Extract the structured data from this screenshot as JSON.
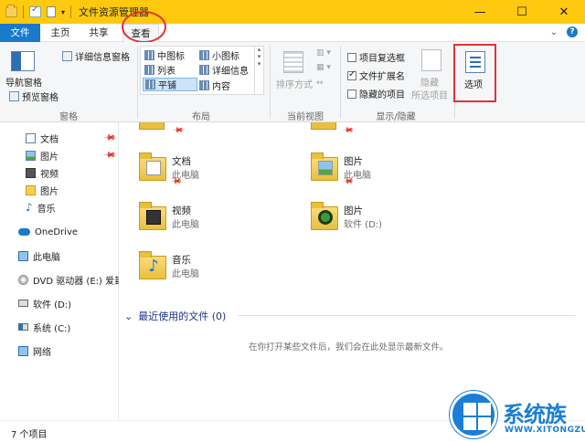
{
  "window": {
    "title": "文件资源管理器",
    "controls": {
      "minimize": "—",
      "maximize": "☐",
      "close": "✕"
    }
  },
  "tabs": {
    "file": "文件",
    "home": "主页",
    "share": "共享",
    "view": "查看",
    "expand": "⌄",
    "help": "?"
  },
  "ribbon": {
    "panes": {
      "label": "窗格",
      "nav_pane": "导航窗格",
      "preview_pane": "预览窗格",
      "details_pane": "详细信息窗格"
    },
    "layout": {
      "label": "布局",
      "items": [
        "中图标",
        "小图标",
        "列表",
        "详细信息",
        "平铺",
        "内容"
      ],
      "selected": "平铺"
    },
    "current_view": {
      "label": "当前视图",
      "sort_by": "排序方式"
    },
    "show_hide": {
      "label": "显示/隐藏",
      "item_checkboxes": "项目复选框",
      "file_extensions": "文件扩展名",
      "hidden_items": "隐藏的项目",
      "hide_selected_line1": "隐藏",
      "hide_selected_line2": "所选项目"
    },
    "options": {
      "label": "选项"
    }
  },
  "nav": {
    "items": [
      {
        "label": "文档",
        "icon": "document-icon",
        "pinned": true
      },
      {
        "label": "图片",
        "icon": "pictures-icon",
        "pinned": true
      },
      {
        "label": "视频",
        "icon": "video-icon",
        "pinned": false
      },
      {
        "label": "图片",
        "icon": "folder-icon",
        "pinned": false
      },
      {
        "label": "音乐",
        "icon": "music-icon",
        "pinned": false
      },
      {
        "label": "OneDrive",
        "icon": "onedrive-icon",
        "pinned": false
      },
      {
        "label": "此电脑",
        "icon": "this-pc-icon",
        "pinned": false
      },
      {
        "label": "DVD 驱动器 (E:) 爱封",
        "icon": "dvd-drive-icon",
        "pinned": false
      },
      {
        "label": "软件 (D:)",
        "icon": "drive-icon",
        "pinned": false
      },
      {
        "label": "系统 (C:)",
        "icon": "system-drive-icon",
        "pinned": false
      },
      {
        "label": "网络",
        "icon": "network-icon",
        "pinned": false
      }
    ]
  },
  "content": {
    "tiles": [
      {
        "name": "文档",
        "sub": "此电脑",
        "pinned": true,
        "icon": "documents-folder-icon"
      },
      {
        "name": "图片",
        "sub": "此电脑",
        "pinned": true,
        "icon": "pictures-folder-icon"
      },
      {
        "name": "视频",
        "sub": "此电脑",
        "pinned": false,
        "icon": "videos-folder-icon"
      },
      {
        "name": "图片",
        "sub": "软件 (D:)",
        "pinned": false,
        "icon": "pictures-drive-folder-icon"
      },
      {
        "name": "音乐",
        "sub": "此电脑",
        "pinned": false,
        "icon": "music-folder-icon"
      }
    ],
    "recent_header": "最近使用的文件 (0)",
    "recent_empty": "在你打开某些文件后，我们会在此处显示最新文件。"
  },
  "status": {
    "item_count": "7 个项目"
  },
  "watermark": {
    "brand": "系统族",
    "url": "WWW.XITONGZU.COM"
  },
  "colors": {
    "titlebar": "#ffc90e",
    "accent": "#1979ca",
    "highlight": "#e0333a"
  }
}
